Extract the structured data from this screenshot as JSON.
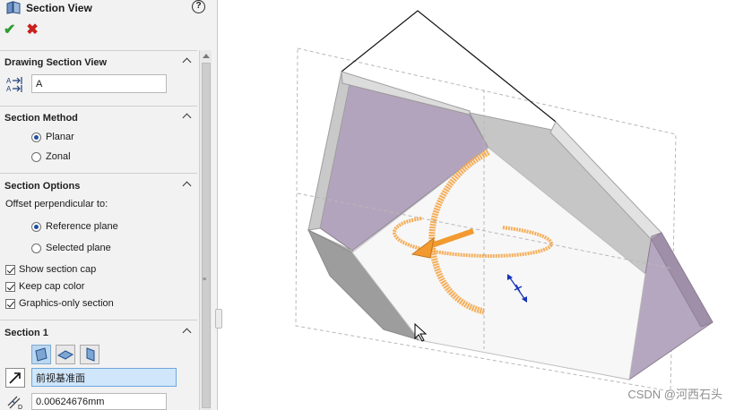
{
  "header": {
    "title": "Section View",
    "help_glyph": "?"
  },
  "confirm": {
    "ok_glyph": "✔",
    "cancel_glyph": "✖"
  },
  "drawing_section_view": {
    "heading": "Drawing Section View",
    "label_value": "A"
  },
  "section_method": {
    "heading": "Section Method",
    "options": [
      "Planar",
      "Zonal"
    ],
    "selected": "Planar"
  },
  "section_options": {
    "heading": "Section Options",
    "offset_label": "Offset perpendicular to:",
    "options": [
      "Reference plane",
      "Selected plane"
    ],
    "selected": "Reference plane",
    "checks": [
      {
        "label": "Show section cap",
        "checked": true
      },
      {
        "label": "Keep cap color",
        "checked": true
      },
      {
        "label": "Graphics-only section",
        "checked": true
      }
    ]
  },
  "section1": {
    "heading": "Section 1",
    "plane_value": "前视基准面",
    "offset_value": "0.00624676mm"
  },
  "watermark": "CSDN @河西石头",
  "colors": {
    "accent_orange": "#f4a74a",
    "cap_purple": "#b3a4bd",
    "ok_green": "#2e9b2e",
    "cancel_red": "#c8201d",
    "selection_blue": "#cfe6fb"
  },
  "icons": [
    "section-view-icon",
    "help-icon",
    "check-icon",
    "close-icon",
    "label-arrow-icon",
    "reverse-direction-icon",
    "offset-distance-icon",
    "triad-icon",
    "mouse-cursor-icon"
  ]
}
